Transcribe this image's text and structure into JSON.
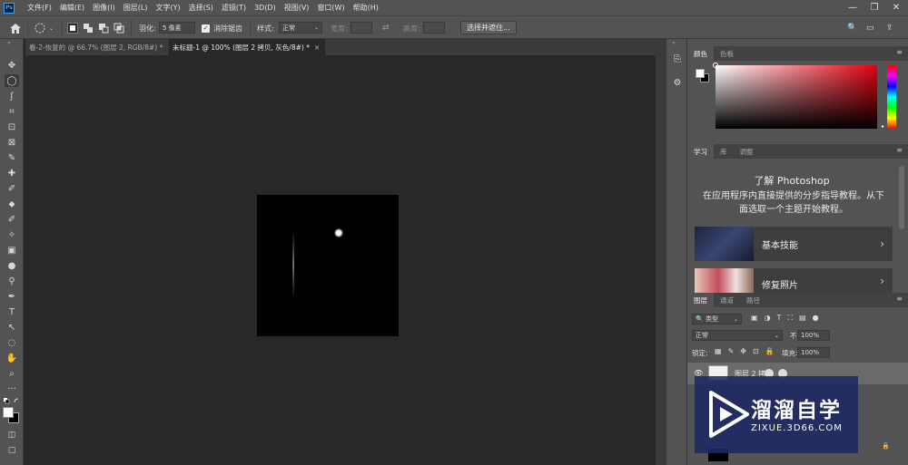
{
  "app": {
    "logo": "Ps",
    "menu": [
      "文件(F)",
      "编辑(E)",
      "图像(I)",
      "图层(L)",
      "文字(Y)",
      "选择(S)",
      "滤镜(T)",
      "3D(D)",
      "视图(V)",
      "窗口(W)",
      "帮助(H)"
    ],
    "window_controls": [
      "—",
      "❐",
      "✕"
    ]
  },
  "options": {
    "feather_label": "羽化:",
    "feather_value": "5 像素",
    "antialias_label": "消除锯齿",
    "style_label": "样式:",
    "style_value": "正常",
    "width_label": "宽度:",
    "height_label": "高度:",
    "select_mask_label": "选择并遮住...",
    "right_icons": [
      "🔍",
      "▭",
      "⇪"
    ]
  },
  "tabs": [
    {
      "label": "看-2-恢复的 @ 66.7% (图层 2, RGB/8#) *",
      "close": "×"
    },
    {
      "label": "未标题-1 @ 100% (图层 2 拷贝, 灰色/8#) *",
      "close": "×"
    }
  ],
  "tools": [
    "✥",
    "◯",
    "ʃ",
    "⌗",
    "⊡",
    "⊠",
    "✎",
    "✚",
    "✐",
    "⬥",
    "✐",
    "✧",
    "▣",
    "●",
    "⚲",
    "✒",
    "T",
    "↖",
    "◌",
    "✋",
    "⌕",
    "···"
  ],
  "colors": {
    "accent": "#31a8ff",
    "panel_bg": "#535353",
    "workspace": "#282828",
    "foreground": "#ffffff",
    "background": "#000000"
  },
  "color_panel": {
    "tabs": [
      "颜色",
      "色板"
    ]
  },
  "learn_panel": {
    "tabs": [
      "学习",
      "库",
      "调整"
    ],
    "title": "了解 Photoshop",
    "description": "在应用程序内直接提供的分步指导教程。从下面选取一个主题开始教程。",
    "cards": [
      {
        "label": "基本技能",
        "arrow": "›"
      },
      {
        "label": "修复照片",
        "arrow": "›"
      }
    ]
  },
  "layers_panel": {
    "tabs": [
      "图层",
      "通道",
      "路径"
    ],
    "filter_kind": "类型",
    "blend_mode": "正常",
    "opacity_label": "不透明度:",
    "opacity_value": "100%",
    "lock_label": "锁定:",
    "fill_label": "填充:",
    "fill_value": "100%",
    "layer_name": "图层 2 拷"
  },
  "watermark": {
    "brand": "溜溜自学",
    "url": "ZIXUE.3D66.COM"
  }
}
